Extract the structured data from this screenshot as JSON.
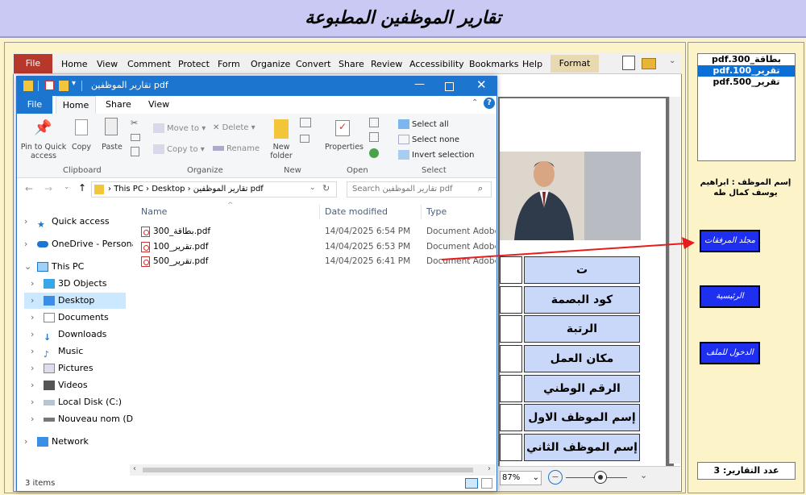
{
  "app": {
    "title": "تقارير الموظفين المطبوعة"
  },
  "right_panel": {
    "list_items": [
      "بطاقة_300.pdf",
      "تقرير_100.pdf",
      "تقرير_500.pdf"
    ],
    "selected_index": 1,
    "employee_name": "إسم الموظف : ابراهيم يوسف كمال طه",
    "buttons": {
      "attachments": "مجلد المرفقات",
      "home": "الرئيسية",
      "open_file": "الدخول للملف"
    },
    "report_count": "عدد التقارير: 3"
  },
  "acrobat": {
    "file_label": "File",
    "menu": [
      "Home",
      "View",
      "Comment",
      "Protect",
      "Form",
      "Organize",
      "Convert",
      "Share",
      "Review",
      "Accessibility",
      "Bookmarks",
      "Help"
    ],
    "format_label": "Format",
    "zoom": "87%",
    "doc_rows": [
      "ت",
      "كود البصمة",
      "الرتبة",
      "مكان العمل",
      "الرقم الوطني",
      "إسم الموظف الاول",
      "إسم الموظف الثاني"
    ]
  },
  "explorer": {
    "title": "تقارير الموظفين pdf",
    "tabs": [
      "File",
      "Home",
      "Share",
      "View"
    ],
    "ribbon": {
      "clipboard": {
        "pin": "Pin to Quick access",
        "copy": "Copy",
        "paste": "Paste",
        "group": "Clipboard"
      },
      "organize": {
        "move_to": "Move to",
        "copy_to": "Copy to",
        "delete": "Delete",
        "rename": "Rename",
        "group": "Organize"
      },
      "new": {
        "new_folder": "New folder",
        "group": "New"
      },
      "open": {
        "properties": "Properties",
        "group": "Open"
      },
      "select": {
        "select_all": "Select all",
        "select_none": "Select none",
        "invert": "Invert selection",
        "group": "Select"
      }
    },
    "address": {
      "segments": [
        "This PC",
        "Desktop",
        "تقارير الموظفين pdf"
      ],
      "search_placeholder": "Search تقارير الموظفين pdf"
    },
    "nav": [
      "Quick access",
      "OneDrive - Personal",
      "This PC",
      "3D Objects",
      "Desktop",
      "Documents",
      "Downloads",
      "Music",
      "Pictures",
      "Videos",
      "Local Disk (C:)",
      "Nouveau nom (D:)",
      "Network"
    ],
    "columns": {
      "name": "Name",
      "date": "Date modified",
      "type": "Type"
    },
    "files": [
      {
        "name": "بطاقة_300.pdf",
        "date": "14/04/2025 6:54 PM",
        "type": "Document Adobe ..."
      },
      {
        "name": "تقرير_100.pdf",
        "date": "14/04/2025 6:53 PM",
        "type": "Document Adobe ..."
      },
      {
        "name": "تقرير_500.pdf",
        "date": "14/04/2025 6:41 PM",
        "type": "Document Adobe ..."
      }
    ],
    "status": "3 items"
  },
  "colors": {
    "accent": "#1c76d0",
    "blue_button": "#1e2ff0",
    "panel_bg": "#fdf3c9",
    "title_bg": "#c9c9f3",
    "arrow": "#e81c1c"
  }
}
